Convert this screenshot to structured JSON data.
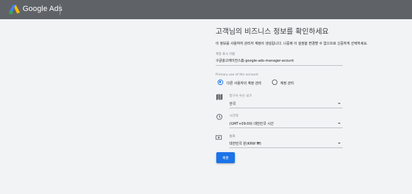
{
  "app": {
    "brand": "Google Ads"
  },
  "form": {
    "title": "고객님의 비즈니스 정보를 확인하세요",
    "intro": "이 정보를 사용하여 관리자 계정이 생성됩니다. 나중에 이 설정을 변경할 수 없으므로 신중하게 선택하세요.",
    "account_name": {
      "label": "계정 표시 이름",
      "value": "구글광고에이전스홈-google-ads-manager-acount"
    },
    "primary_use": {
      "label": "Primary use of the account",
      "options": [
        {
          "label": "다른 사용자의 계정 관리",
          "selected": true
        },
        {
          "label": "계정 관리",
          "selected": false
        }
      ]
    },
    "billing_country": {
      "label": "청구서 수신 국가",
      "value": "한국",
      "icon": "map-icon"
    },
    "timezone": {
      "label": "시간대",
      "value": "(GMT+09:00) 대한민국 시간",
      "icon": "clock-icon"
    },
    "currency": {
      "label": "통화",
      "value": "대한민국 원(KRW ₩)",
      "icon": "money-icon"
    },
    "submit_label": "제출"
  },
  "colors": {
    "topbar": "#5f6368",
    "accent": "#1a73e8",
    "background": "#f1f3f4"
  }
}
